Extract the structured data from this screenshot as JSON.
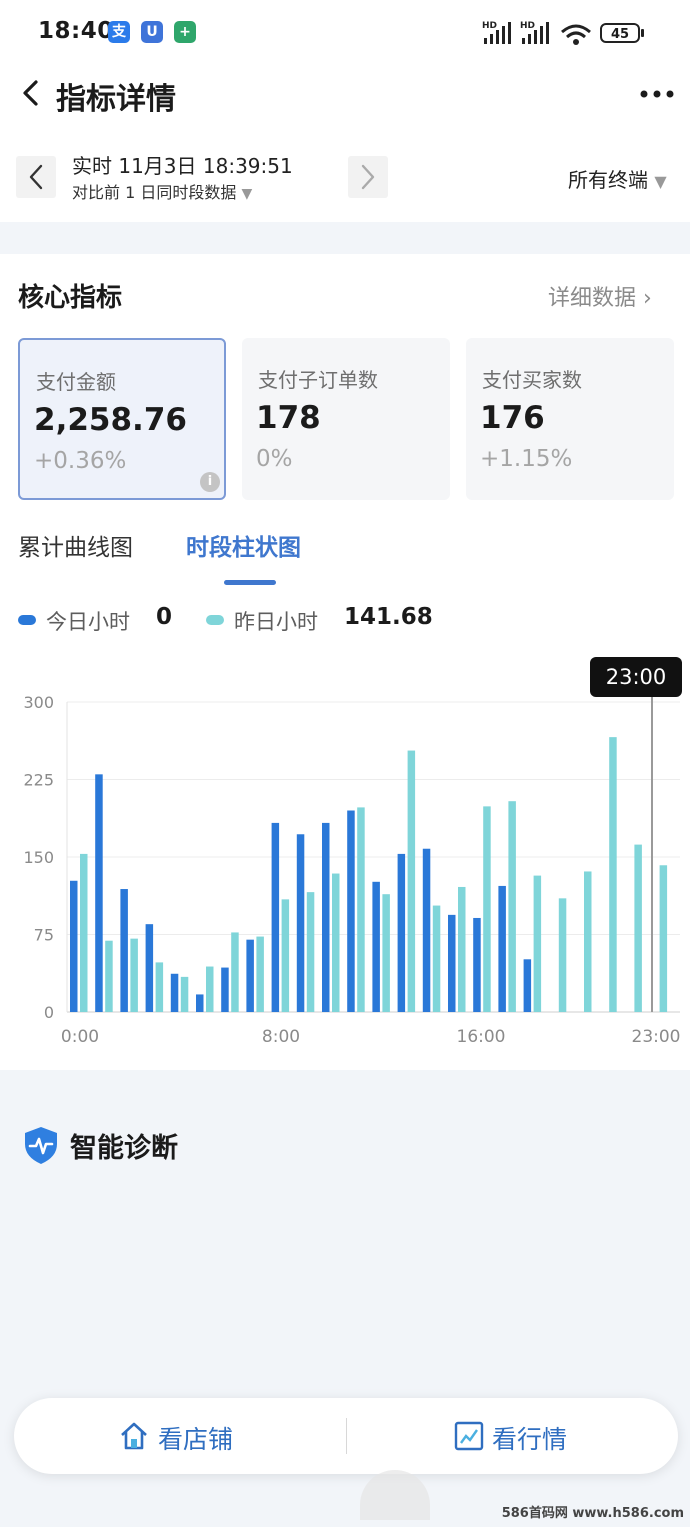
{
  "status_bar": {
    "time": "18:40",
    "app_icons": [
      "alipay-icon",
      "shield-app-icon",
      "green-shield-app-icon"
    ],
    "signal_labels": [
      "HD",
      "HD"
    ],
    "battery": "45"
  },
  "header": {
    "title": "指标详情",
    "back_icon": "chevron-left-icon",
    "more_icon": "more-dots-icon"
  },
  "date_bar": {
    "main_label": "实时 11月3日 18:39:51",
    "sub_label": "对比前 1 日同时段数据",
    "terminal_label": "所有终端"
  },
  "core": {
    "title": "核心指标",
    "detail_link": "详细数据",
    "metrics": [
      {
        "label": "支付金额",
        "value": "2,258.76",
        "change": "+0.36%",
        "active": true
      },
      {
        "label": "支付子订单数",
        "value": "178",
        "change": "0%"
      },
      {
        "label": "支付买家数",
        "value": "176",
        "change": "+1.15%"
      }
    ]
  },
  "tabs": [
    {
      "label": "累计曲线图",
      "active": false
    },
    {
      "label": "时段柱状图",
      "active": true
    }
  ],
  "legend": {
    "today_label": "今日小时",
    "today_value": "0",
    "yesterday_label": "昨日小时",
    "yesterday_value": "141.68"
  },
  "tooltip": "23:00",
  "chart_data": {
    "type": "bar",
    "categories": [
      "0:00",
      "1:00",
      "2:00",
      "3:00",
      "4:00",
      "5:00",
      "6:00",
      "7:00",
      "8:00",
      "9:00",
      "10:00",
      "11:00",
      "12:00",
      "13:00",
      "14:00",
      "15:00",
      "16:00",
      "17:00",
      "18:00",
      "19:00",
      "20:00",
      "21:00",
      "22:00",
      "23:00"
    ],
    "series": [
      {
        "name": "今日小时",
        "color": "#2a78d8",
        "values": [
          127,
          230,
          119,
          85,
          37,
          17,
          43,
          70,
          183,
          172,
          183,
          195,
          126,
          153,
          158,
          94,
          91,
          122,
          51,
          null,
          null,
          null,
          null,
          null
        ]
      },
      {
        "name": "昨日小时",
        "color": "#7fd5d9",
        "values": [
          153,
          69,
          71,
          48,
          34,
          44,
          77,
          73,
          109,
          116,
          134,
          198,
          114,
          253,
          103,
          121,
          199,
          204,
          132,
          110,
          136,
          266,
          162,
          142
        ]
      }
    ],
    "y_ticks": [
      "300",
      "225",
      "150",
      "75",
      "0"
    ],
    "x_ticks": [
      "0:00",
      "8:00",
      "16:00",
      "23:00"
    ],
    "ylim": [
      0,
      300
    ],
    "grid": true
  },
  "diagnosis": {
    "title": "智能诊断",
    "icon": "pulse-shield-icon"
  },
  "bottom_nav": {
    "store_label": "看店铺",
    "store_icon": "home-icon",
    "market_label": "看行情",
    "market_icon": "chart-icon"
  },
  "watermark": "586首码网 www.h586.com"
}
